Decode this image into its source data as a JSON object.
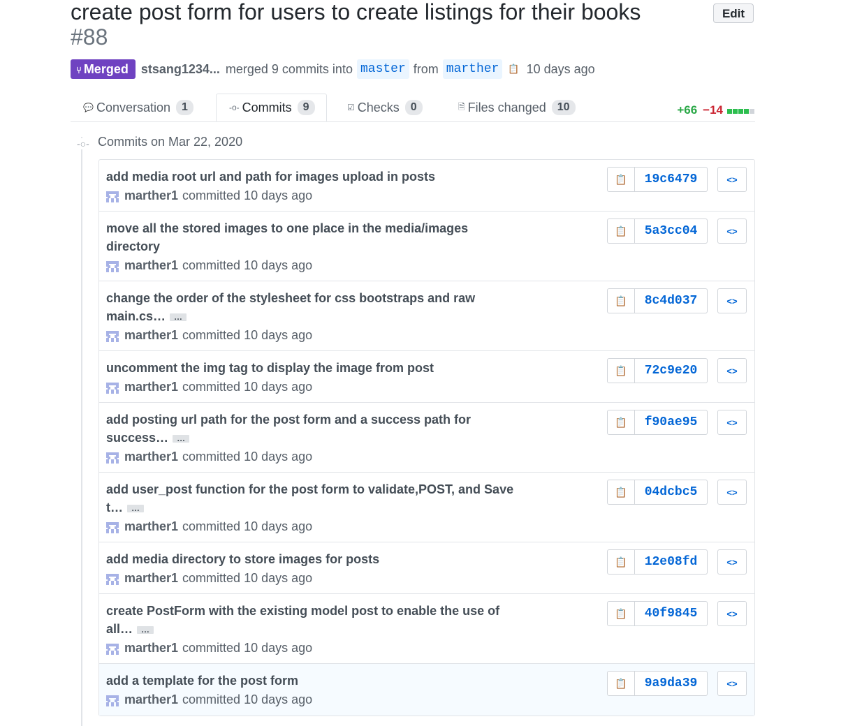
{
  "pr": {
    "title": "create post form for users to create listings for their books",
    "number": "#88",
    "edit_label": "Edit",
    "state_label": "Merged",
    "author": "stsang1234...",
    "merged_text": "merged 9 commits into",
    "base_branch": "master",
    "from_text": "from",
    "head_branch": "marther",
    "time": "10 days ago"
  },
  "tabs": [
    {
      "label": "Conversation",
      "count": "1",
      "icon": "comment-icon"
    },
    {
      "label": "Commits",
      "count": "9",
      "icon": "commit-icon"
    },
    {
      "label": "Checks",
      "count": "0",
      "icon": "checks-icon"
    },
    {
      "label": "Files changed",
      "count": "10",
      "icon": "file-diff-icon"
    }
  ],
  "diffstat": {
    "additions": "+66",
    "deletions": "−14",
    "blocks": [
      "green",
      "green",
      "green",
      "green",
      "gray"
    ]
  },
  "commits_header": "Commits on Mar 22, 2020",
  "commits": [
    {
      "message": "add media root url and path for images upload in posts",
      "truncated": false,
      "author": "marther1",
      "committed": "committed 10 days ago",
      "sha": "19c6479"
    },
    {
      "message": "move all the stored images to one place in the media/images directory",
      "truncated": false,
      "author": "marther1",
      "committed": "committed 10 days ago",
      "sha": "5a3cc04"
    },
    {
      "message": "change the order of the stylesheet for css bootstraps and raw main.cs…",
      "truncated": true,
      "author": "marther1",
      "committed": "committed 10 days ago",
      "sha": "8c4d037"
    },
    {
      "message": "uncomment the img tag to display the image from post",
      "truncated": false,
      "author": "marther1",
      "committed": "committed 10 days ago",
      "sha": "72c9e20"
    },
    {
      "message": "add posting url path for the post form and a success path for success…",
      "truncated": true,
      "author": "marther1",
      "committed": "committed 10 days ago",
      "sha": "f90ae95"
    },
    {
      "message": "add user_post function for the post form to validate,POST, and Save t…",
      "truncated": true,
      "author": "marther1",
      "committed": "committed 10 days ago",
      "sha": "04dcbc5"
    },
    {
      "message": "add media directory to store images for posts",
      "truncated": false,
      "author": "marther1",
      "committed": "committed 10 days ago",
      "sha": "12e08fd"
    },
    {
      "message": "create PostForm with the existing model post to enable the use of all…",
      "truncated": true,
      "author": "marther1",
      "committed": "committed 10 days ago",
      "sha": "40f9845"
    },
    {
      "message": "add a template for the post form",
      "truncated": false,
      "author": "marther1",
      "committed": "committed 10 days ago",
      "sha": "9a9da39"
    }
  ],
  "colors": {
    "merged": "#6f42c1",
    "link": "#0366d6",
    "additions": "#28a745",
    "deletions": "#cb2431"
  }
}
